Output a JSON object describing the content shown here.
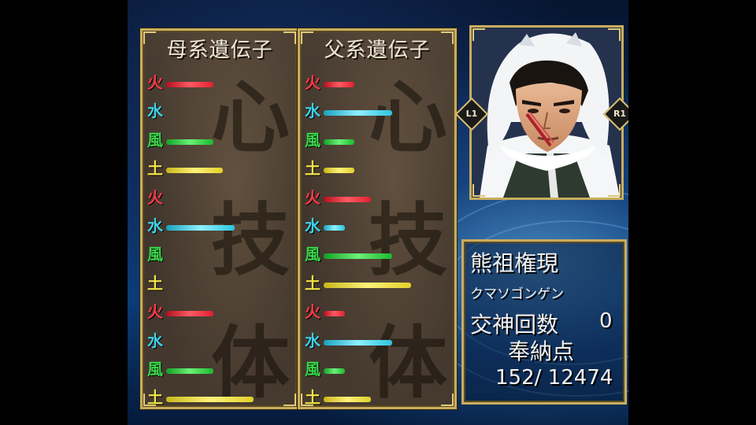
{
  "maternal": {
    "title": "母系遺伝子",
    "genes": [
      {
        "element": "火",
        "type": "fire",
        "level": 0.4
      },
      {
        "element": "水",
        "type": "water",
        "level": 0.0
      },
      {
        "element": "風",
        "type": "wind",
        "level": 0.4
      },
      {
        "element": "土",
        "type": "earth",
        "level": 0.48
      },
      {
        "element": "火",
        "type": "fire",
        "level": 0.0
      },
      {
        "element": "水",
        "type": "water",
        "level": 0.58
      },
      {
        "element": "風",
        "type": "wind",
        "level": 0.0
      },
      {
        "element": "土",
        "type": "earth",
        "level": 0.0
      },
      {
        "element": "火",
        "type": "fire",
        "level": 0.4
      },
      {
        "element": "水",
        "type": "water",
        "level": 0.0
      },
      {
        "element": "風",
        "type": "wind",
        "level": 0.4
      },
      {
        "element": "土",
        "type": "earth",
        "level": 0.74
      }
    ]
  },
  "paternal": {
    "title": "父系遺伝子",
    "genes": [
      {
        "element": "火",
        "type": "fire",
        "level": 0.26
      },
      {
        "element": "水",
        "type": "water",
        "level": 0.58
      },
      {
        "element": "風",
        "type": "wind",
        "level": 0.26
      },
      {
        "element": "土",
        "type": "earth",
        "level": 0.26
      },
      {
        "element": "火",
        "type": "fire",
        "level": 0.4
      },
      {
        "element": "水",
        "type": "water",
        "level": 0.18
      },
      {
        "element": "風",
        "type": "wind",
        "level": 0.58
      },
      {
        "element": "土",
        "type": "earth",
        "level": 0.74
      },
      {
        "element": "火",
        "type": "fire",
        "level": 0.18
      },
      {
        "element": "水",
        "type": "water",
        "level": 0.58
      },
      {
        "element": "風",
        "type": "wind",
        "level": 0.18
      },
      {
        "element": "土",
        "type": "earth",
        "level": 0.4
      }
    ]
  },
  "background_kanji": [
    "心",
    "技",
    "体"
  ],
  "portrait": {
    "prev_button": "L1",
    "next_button": "R1"
  },
  "info": {
    "name": "熊祖権現",
    "reading": "クマソゴンゲン",
    "mating_label": "交神回数",
    "mating_count": "0",
    "offering_label": "奉納点",
    "offering_value": "152/ 12474"
  },
  "colors": {
    "fire": "#ff3a48",
    "water": "#3fd0e6",
    "wind": "#3ad64a",
    "earth": "#f2e24a",
    "frame_gold": "#c9ad5e"
  }
}
